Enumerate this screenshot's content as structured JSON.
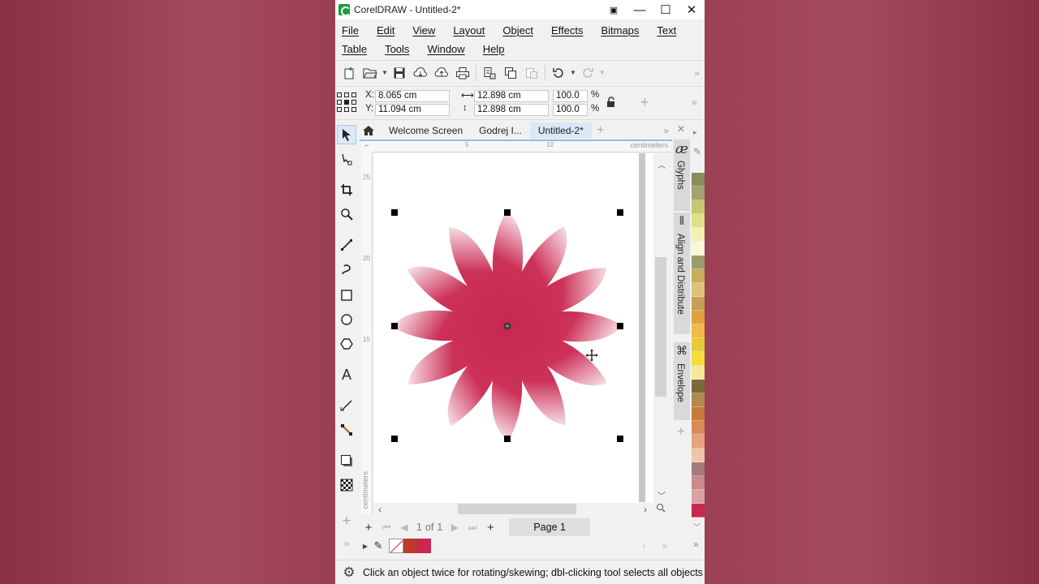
{
  "window": {
    "title": "CorelDRAW - Untitled-2*"
  },
  "menu": {
    "row1": [
      "File",
      "Edit",
      "View",
      "Layout",
      "Object",
      "Effects",
      "Bitmaps",
      "Text"
    ],
    "row2": [
      "Table",
      "Tools",
      "Window",
      "Help"
    ]
  },
  "properties": {
    "x_label": "X:",
    "x_value": "8.065 cm",
    "y_label": "Y:",
    "y_value": "11.094 cm",
    "width_value": "12.898 cm",
    "height_value": "12.898 cm",
    "scale_w": "100.0",
    "scale_h": "100.0",
    "percent": "%"
  },
  "doc_tabs": [
    "Welcome Screen",
    "Godrej I...",
    "Untitled-2*"
  ],
  "active_tab": "Untitled-2*",
  "rulers": {
    "unit": "centimeters",
    "h_ticks": [
      "5",
      "10"
    ],
    "v_ticks": [
      "25",
      "20",
      "15"
    ]
  },
  "page_nav": {
    "current": "1",
    "of_label": "of",
    "total": "1",
    "page_tab": "Page 1"
  },
  "status": {
    "message": "Click an object twice for rotating/skewing; dbl-clicking tool selects all objects"
  },
  "dockers": [
    "Glyphs",
    "Align and Distribute",
    "Envelope"
  ],
  "colors": {
    "petal": "#c8284f",
    "petal_light": "#f7dde3",
    "doc_palette": [
      "#c0392b",
      "#c8284f"
    ],
    "palette": [
      "#8b8b5c",
      "#a3a370",
      "#c7c76e",
      "#dfe08a",
      "#f2f1b2",
      "#fbf7d6",
      "#9d9a6a",
      "#c8ac5c",
      "#dfc27a",
      "#c79d58",
      "#e0a03b",
      "#f2b94a",
      "#e7c93b",
      "#f6dc3a",
      "#f7e79a",
      "#7a6a3a",
      "#b08a4a",
      "#c77a3a",
      "#d98a5a",
      "#e6a27e",
      "#efc4a8",
      "#a67a7a",
      "#c88a8a",
      "#d9a2a2",
      "#c8284f"
    ]
  },
  "icons": {
    "toolbox": [
      "pick-tool-icon",
      "shape-tool-icon",
      "crop-tool-icon",
      "zoom-tool-icon",
      "freehand-tool-icon",
      "artistic-media-icon",
      "rectangle-tool-icon",
      "ellipse-tool-icon",
      "polygon-tool-icon",
      "text-tool-icon",
      "parallel-dimension-icon",
      "connector-tool-icon",
      "drop-shadow-icon",
      "transparency-tool-icon",
      "add-tool-icon"
    ]
  }
}
